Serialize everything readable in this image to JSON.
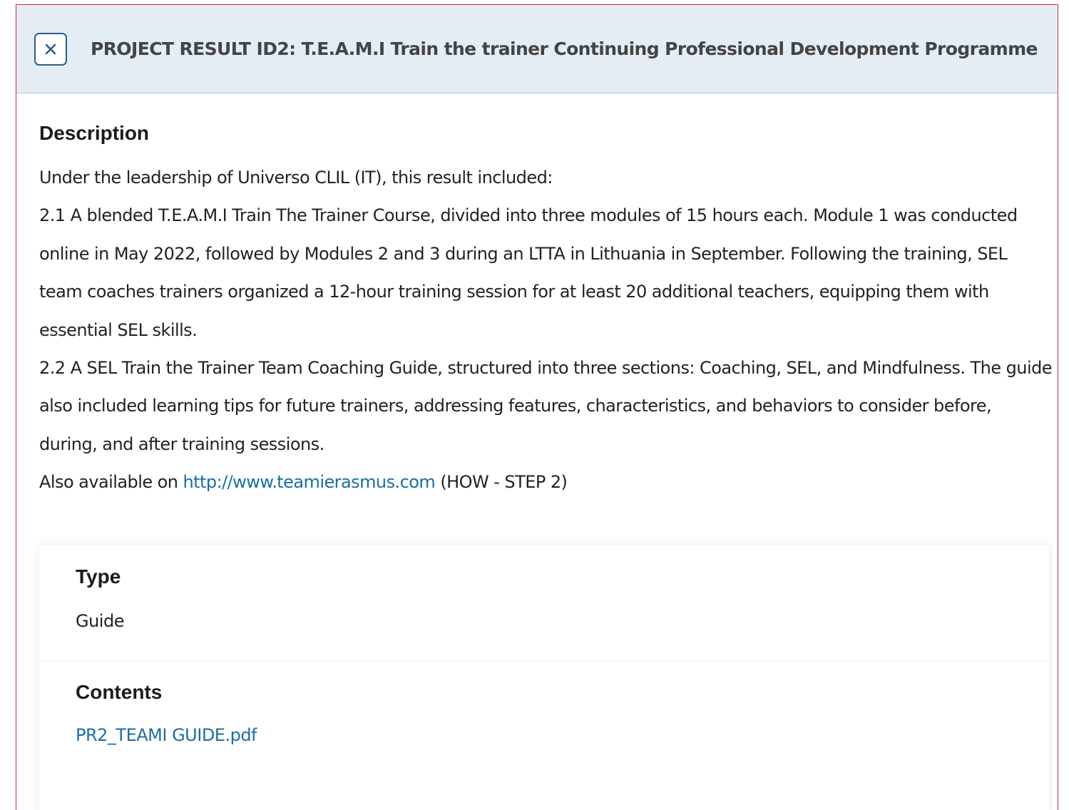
{
  "modal": {
    "title": "PROJECT RESULT ID2: T.E.A.M.I Train the trainer Continuing Professional Development Programme",
    "close_icon": "close-icon"
  },
  "description": {
    "heading": "Description",
    "paragraphs": [
      "Under the leadership of Universo CLIL (IT), this result included:",
      "2.1 A blended T.E.A.M.I Train The Trainer Course, divided into three modules of 15 hours each. Module 1 was conducted online in May 2022, followed by Modules 2 and 3 during an LTTA in Lithuania in September. Following the training, SEL team coaches trainers organized a 12-hour training session for at least 20 additional teachers, equipping them with essential SEL skills.",
      "2.2 A SEL Train the Trainer Team Coaching Guide, structured into three sections: Coaching, SEL, and Mindfulness. The guide also included learning tips for future trainers, addressing features, characteristics, and behaviors to consider before, during, and after training sessions."
    ],
    "availability": {
      "prefix": "Also available on ",
      "link_text": "http://www.teamierasmus.com",
      "suffix": " (HOW - STEP 2)"
    }
  },
  "type": {
    "heading": "Type",
    "value": "Guide"
  },
  "contents": {
    "heading": "Contents",
    "file_link": "PR2_TEAMI GUIDE.pdf"
  },
  "colors": {
    "header_bg": "#e5edf4",
    "accent": "#2c5d8f",
    "link": "#1a6fa5",
    "frame_border": "#c4303f"
  }
}
